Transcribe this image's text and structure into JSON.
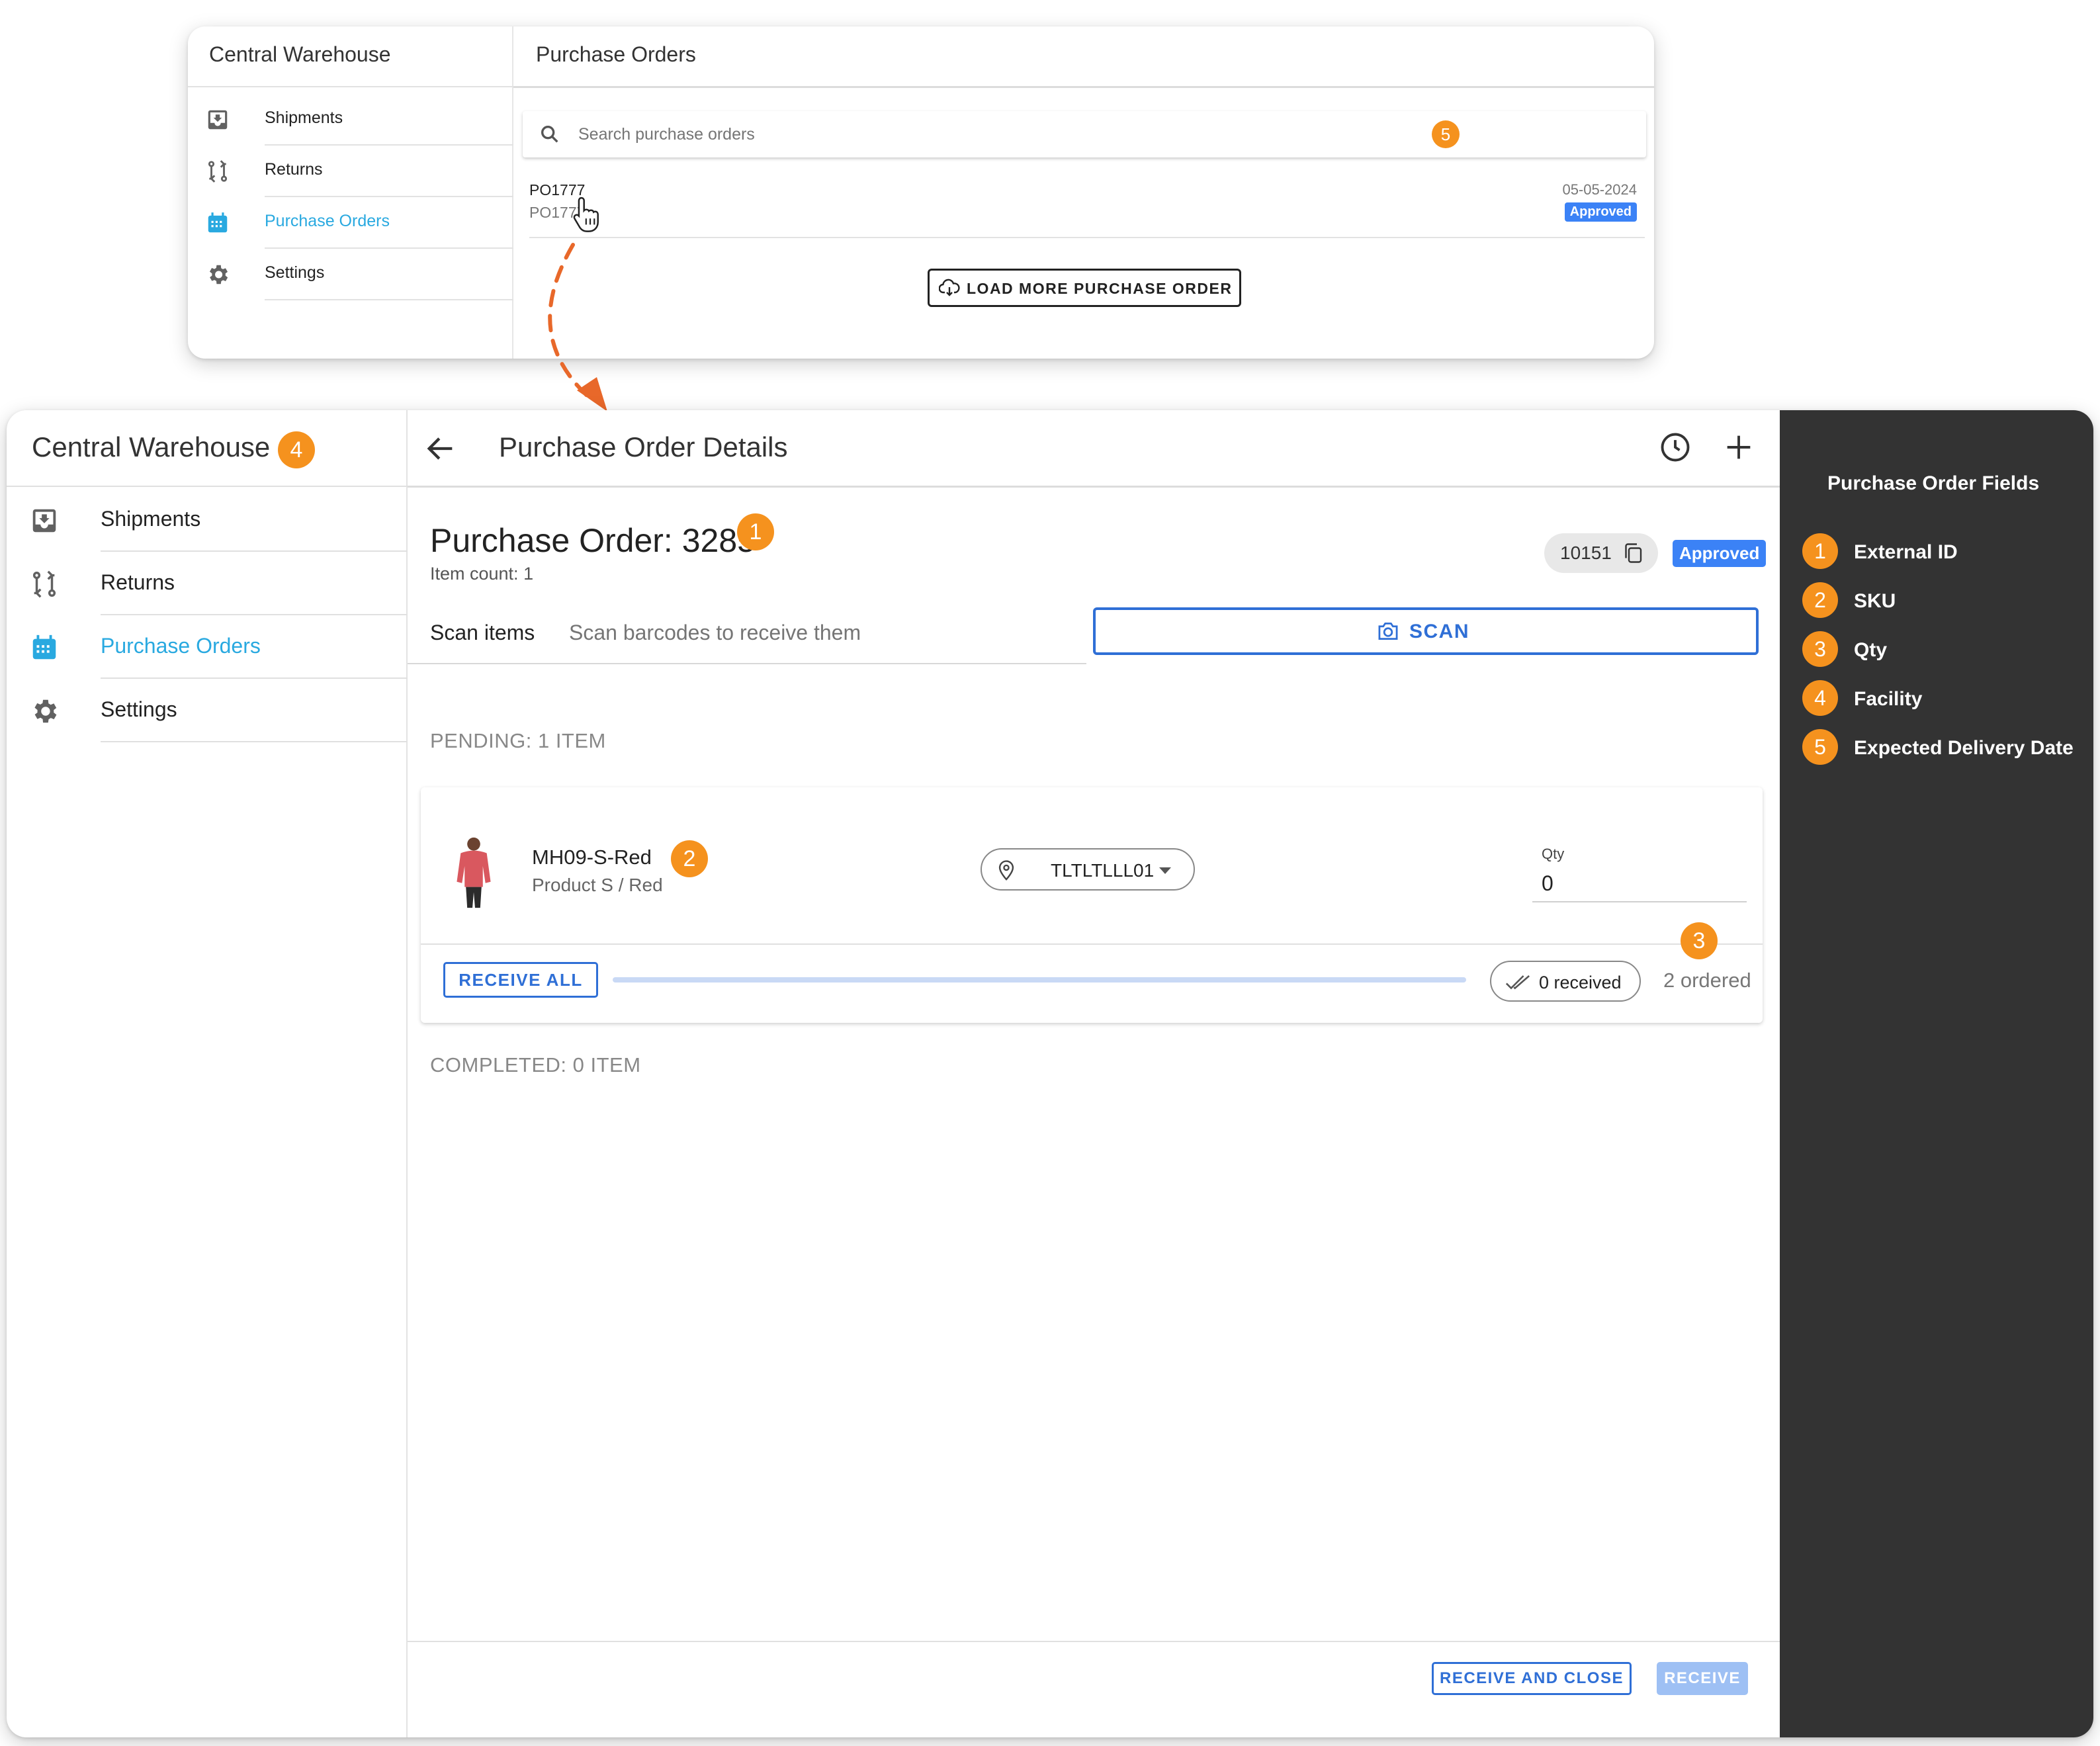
{
  "colors": {
    "accent_blue": "#2f6fd6",
    "nav_active": "#29a9e0",
    "annotation_orange": "#f5921e",
    "arrow_orange": "#e8682a",
    "status_approved": "#3b82f6",
    "legend_bg": "#333333"
  },
  "list_view": {
    "sidebar": {
      "title": "Central Warehouse",
      "items": [
        {
          "label": "Shipments",
          "icon": "inbox-download-icon"
        },
        {
          "label": "Returns",
          "icon": "git-compare-icon"
        },
        {
          "label": "Purchase Orders",
          "icon": "calendar-icon",
          "active": true
        },
        {
          "label": "Settings",
          "icon": "gear-icon"
        }
      ]
    },
    "header": {
      "title": "Purchase Orders"
    },
    "search": {
      "placeholder": "Search purchase orders"
    },
    "orders": [
      {
        "id": "PO1777",
        "external_id": "PO1777",
        "date": "05-05-2024",
        "status": "Approved"
      }
    ],
    "load_more_label": "LOAD MORE PURCHASE ORDER"
  },
  "detail_view": {
    "sidebar": {
      "title": "Central Warehouse",
      "items": [
        {
          "label": "Shipments",
          "icon": "inbox-download-icon"
        },
        {
          "label": "Returns",
          "icon": "git-compare-icon"
        },
        {
          "label": "Purchase Orders",
          "icon": "calendar-icon",
          "active": true
        },
        {
          "label": "Settings",
          "icon": "gear-icon"
        }
      ]
    },
    "header": {
      "title": "Purchase Order Details"
    },
    "po": {
      "title": "Purchase Order: 3285",
      "item_count": "Item count: 1",
      "external_id": "10151",
      "status": "Approved"
    },
    "scan": {
      "label": "Scan items",
      "placeholder": "Scan barcodes to receive them",
      "button_label": "SCAN"
    },
    "pending_heading": "PENDING: 1 ITEM",
    "items": [
      {
        "sku": "MH09-S-Red",
        "variant": "Product S / Red",
        "location": "TLTLTLLL01",
        "qty_label": "Qty",
        "qty_value": "0",
        "receive_all_label": "RECEIVE ALL",
        "received_label": "0 received",
        "ordered_label": "2 ordered",
        "received_fraction": 0
      }
    ],
    "completed_heading": "COMPLETED: 0 ITEM",
    "footer": {
      "receive_and_close_label": "RECEIVE AND CLOSE",
      "receive_label": "RECEIVE"
    }
  },
  "legend": {
    "title": "Purchase Order Fields",
    "items": [
      {
        "num": "1",
        "label": "External ID"
      },
      {
        "num": "2",
        "label": "SKU"
      },
      {
        "num": "3",
        "label": "Qty"
      },
      {
        "num": "4",
        "label": "Facility"
      },
      {
        "num": "5",
        "label": "Expected Delivery Date"
      }
    ]
  },
  "annotations": {
    "po_title": "1",
    "sku": "2",
    "qty": "3",
    "facility": "4",
    "delivery_date": "5"
  }
}
